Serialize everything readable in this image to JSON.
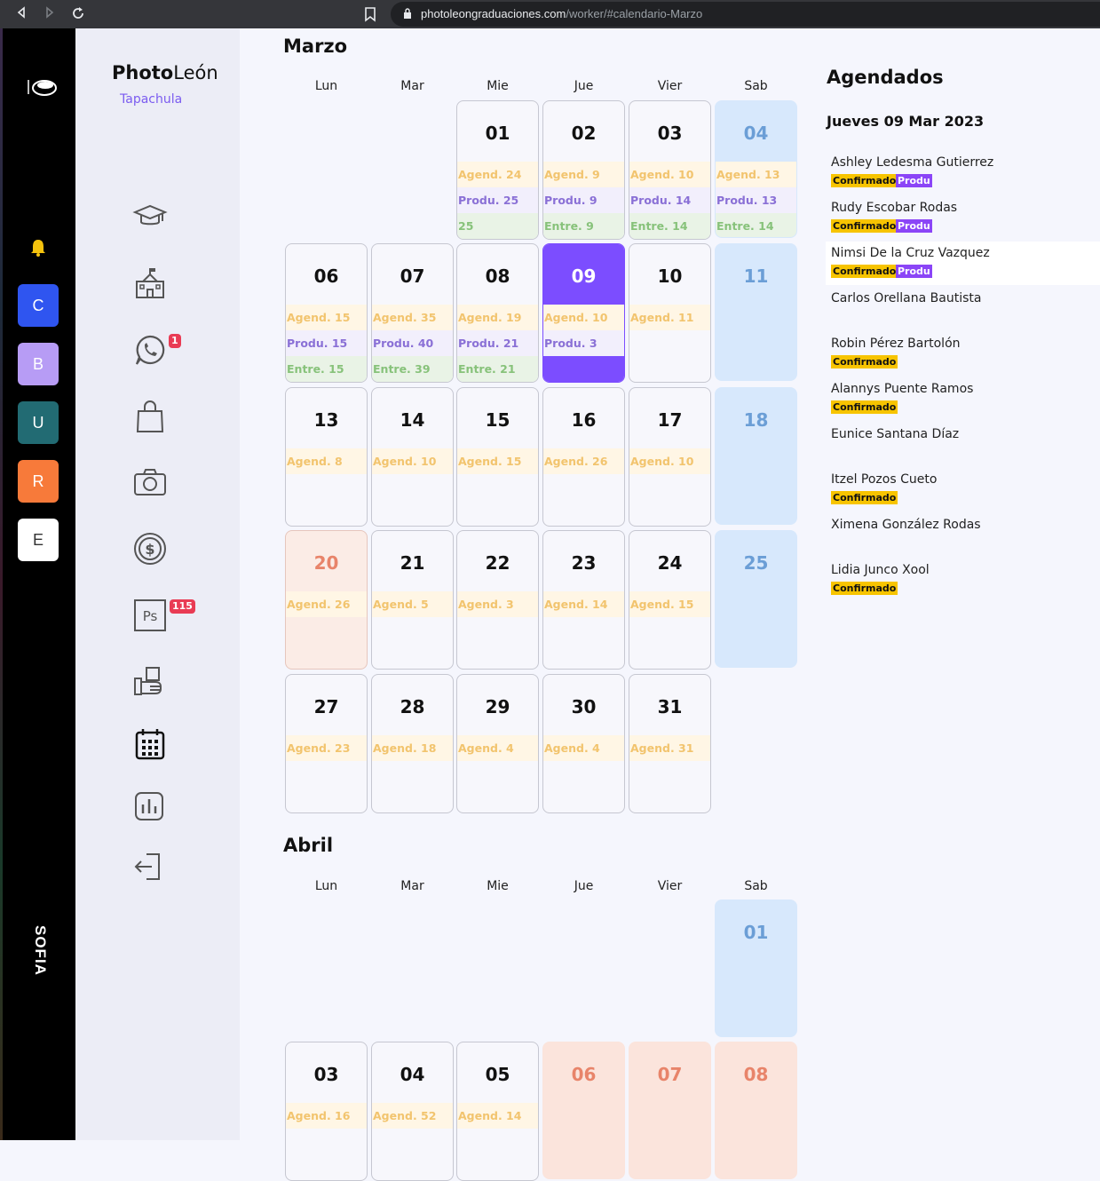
{
  "browser": {
    "url_domain": "photoleongraduaciones.com",
    "url_path": "/worker/#calendario-Marzo"
  },
  "rail": {
    "avatars": [
      {
        "letter": "C",
        "color": "#2f55f0"
      },
      {
        "letter": "B",
        "color": "#b79cf5"
      },
      {
        "letter": "U",
        "color": "#226b73"
      },
      {
        "letter": "R",
        "color": "#f77a3a"
      },
      {
        "letter": "E",
        "color": "#ffffff"
      }
    ],
    "user": "SOFIA"
  },
  "sidenav": {
    "brand_bold": "Photo",
    "brand_light": "León",
    "branch": "Tapachula",
    "whatsapp_badge": "1",
    "ps_badge": "115"
  },
  "weekdays": [
    "Lun",
    "Mar",
    "Mie",
    "Jue",
    "Vier",
    "Sab"
  ],
  "months": [
    {
      "title": "Marzo",
      "days": [
        {
          "day": "01",
          "agend": "Agend. 24",
          "produ": "Produ. 25",
          "entre": "25"
        },
        {
          "day": "02",
          "agend": "Agend. 9",
          "produ": "Produ. 9",
          "entre": "Entre. 9"
        },
        {
          "day": "03",
          "agend": "Agend. 10",
          "produ": "Produ. 14",
          "entre": "Entre. 14"
        },
        {
          "day": "04",
          "agend": "Agend. 13",
          "produ": "Produ. 13",
          "entre": "Entre. 14"
        },
        {
          "day": "06",
          "agend": "Agend. 15",
          "produ": "Produ. 15",
          "entre": "Entre. 15"
        },
        {
          "day": "07",
          "agend": "Agend. 35",
          "produ": "Produ. 40",
          "entre": "Entre. 39"
        },
        {
          "day": "08",
          "agend": "Agend. 19",
          "produ": "Produ. 21",
          "entre": "Entre. 21"
        },
        {
          "day": "09",
          "agend": "Agend. 10",
          "produ": "Produ. 3"
        },
        {
          "day": "10",
          "agend": "Agend. 11"
        },
        {
          "day": "11"
        },
        {
          "day": "13",
          "agend": "Agend. 8"
        },
        {
          "day": "14",
          "agend": "Agend. 10"
        },
        {
          "day": "15",
          "agend": "Agend. 15"
        },
        {
          "day": "16",
          "agend": "Agend. 26"
        },
        {
          "day": "17",
          "agend": "Agend. 10"
        },
        {
          "day": "18"
        },
        {
          "day": "20",
          "agend": "Agend. 26"
        },
        {
          "day": "21",
          "agend": "Agend. 5"
        },
        {
          "day": "22",
          "agend": "Agend. 3"
        },
        {
          "day": "23",
          "agend": "Agend. 14"
        },
        {
          "day": "24",
          "agend": "Agend. 15"
        },
        {
          "day": "25"
        },
        {
          "day": "27",
          "agend": "Agend. 23"
        },
        {
          "day": "28",
          "agend": "Agend. 18"
        },
        {
          "day": "29",
          "agend": "Agend. 4"
        },
        {
          "day": "30",
          "agend": "Agend. 4"
        },
        {
          "day": "31",
          "agend": "Agend. 31"
        }
      ]
    },
    {
      "title": "Abril",
      "days": [
        {
          "day": "01"
        },
        {
          "day": "03",
          "agend": "Agend. 16"
        },
        {
          "day": "04",
          "agend": "Agend. 52"
        },
        {
          "day": "05",
          "agend": "Agend. 14"
        },
        {
          "day": "06"
        },
        {
          "day": "07"
        },
        {
          "day": "08"
        }
      ]
    }
  ],
  "agenda": {
    "title": "Agendados",
    "date": "Jueves 09 Mar 2023",
    "people": [
      {
        "name": "Ashley Ledesma Gutierrez",
        "confirmed": "Confirmado",
        "produ": "Produ"
      },
      {
        "name": "Rudy Escobar Rodas",
        "confirmed": "Confirmado",
        "produ": "Produ"
      },
      {
        "name": "Nimsi De la Cruz Vazquez",
        "confirmed": "Confirmado",
        "produ": "Produ"
      },
      {
        "name": "Carlos Orellana Bautista"
      },
      {
        "name": "Robin Pérez Bartolón",
        "confirmed": "Confirmado"
      },
      {
        "name": "Alannys Puente Ramos",
        "confirmed": "Confirmado"
      },
      {
        "name": "Eunice Santana Díaz"
      },
      {
        "name": "Itzel Pozos Cueto",
        "confirmed": "Confirmado"
      },
      {
        "name": "Ximena González Rodas"
      },
      {
        "name": "Lidia Junco Xool",
        "confirmed": "Confirmado"
      }
    ]
  }
}
